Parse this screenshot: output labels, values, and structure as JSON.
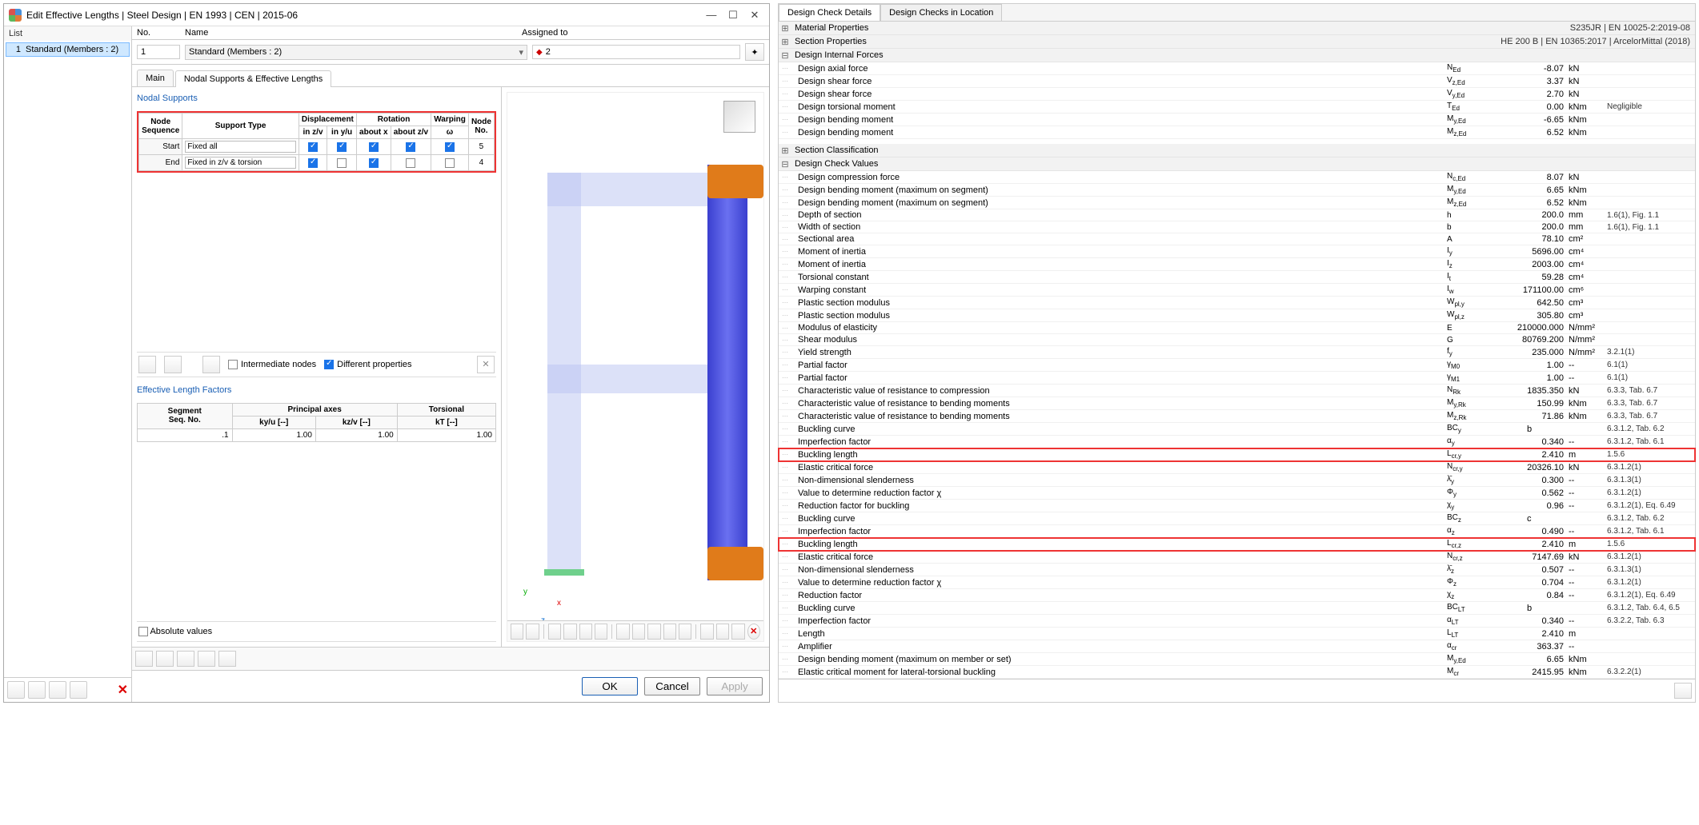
{
  "dialog": {
    "title": "Edit Effective Lengths | Steel Design | EN 1993 | CEN | 2015-06",
    "list_header": "List",
    "list_item_no": "1",
    "list_item_name": "Standard (Members : 2)",
    "hdr_no": "No.",
    "hdr_name": "Name",
    "hdr_assigned": "Assigned to",
    "val_no": "1",
    "val_name": "Standard (Members : 2)",
    "val_assigned": "2",
    "tab_main": "Main",
    "tab_nodal": "Nodal Supports & Effective Lengths",
    "section_nodal": "Nodal Supports",
    "ns_hdr": {
      "node_seq1": "Node",
      "node_seq2": "Sequence",
      "support_type": "Support Type",
      "disp": "Displacement",
      "in_zv": "in z/v",
      "in_yu": "in y/u",
      "rot": "Rotation",
      "about_x": "about x",
      "about_zv": "about z/v",
      "warp": "Warping",
      "omega": "ω",
      "node_no1": "Node",
      "node_no2": "No."
    },
    "ns_rows": [
      {
        "seq": "Start",
        "type": "Fixed all",
        "zv": true,
        "yu": true,
        "ax": true,
        "azv": true,
        "w": true,
        "node": "5"
      },
      {
        "seq": "End",
        "type": "Fixed in z/v & torsion",
        "zv": true,
        "yu": false,
        "ax": true,
        "azv": false,
        "w": false,
        "node": "4"
      }
    ],
    "chk_intermediate": "Intermediate nodes",
    "chk_different": "Different properties",
    "section_elf": "Effective Length Factors",
    "elf_hdr": {
      "seg1": "Segment",
      "seg2": "Seq. No.",
      "principal": "Principal axes",
      "ky": "ky/u [--]",
      "kz": "kz/v [--]",
      "torsional": "Torsional",
      "kt": "kT [--]"
    },
    "elf_row": {
      "seg": ".1",
      "ky": "1.00",
      "kz": "1.00",
      "kt": "1.00"
    },
    "chk_absolute": "Absolute values",
    "btn_ok": "OK",
    "btn_cancel": "Cancel",
    "btn_apply": "Apply"
  },
  "lcs": {
    "x": "x",
    "y": "y",
    "z": "z"
  },
  "props": {
    "tab1": "Design Check Details",
    "tab2": "Design Checks in Location",
    "cat_mat": "Material Properties",
    "cat_mat_val": "S235JR | EN 10025-2:2019-08",
    "cat_sec": "Section Properties",
    "cat_sec_val": "HE 200 B | EN 10365:2017 | ArcelorMittal (2018)",
    "cat_dif": "Design Internal Forces",
    "dif": [
      {
        "n": "Design axial force",
        "s": "N<sub>Ed</sub>",
        "v": "-8.07",
        "u": "kN",
        "r": ""
      },
      {
        "n": "Design shear force",
        "s": "V<sub>z,Ed</sub>",
        "v": "3.37",
        "u": "kN",
        "r": ""
      },
      {
        "n": "Design shear force",
        "s": "V<sub>y,Ed</sub>",
        "v": "2.70",
        "u": "kN",
        "r": ""
      },
      {
        "n": "Design torsional moment",
        "s": "T<sub>Ed</sub>",
        "v": "0.00",
        "u": "kNm",
        "r": "Negligible"
      },
      {
        "n": "Design bending moment",
        "s": "M<sub>y,Ed</sub>",
        "v": "-6.65",
        "u": "kNm",
        "r": ""
      },
      {
        "n": "Design bending moment",
        "s": "M<sub>z,Ed</sub>",
        "v": "6.52",
        "u": "kNm",
        "r": ""
      }
    ],
    "cat_cls": "Section Classification",
    "cat_dcv": "Design Check Values",
    "dcv": [
      {
        "n": "Design compression force",
        "s": "N<sub>c,Ed</sub>",
        "v": "8.07",
        "u": "kN",
        "r": ""
      },
      {
        "n": "Design bending moment (maximum on segment)",
        "s": "M<sub>y,Ed</sub>",
        "v": "6.65",
        "u": "kNm",
        "r": ""
      },
      {
        "n": "Design bending moment (maximum on segment)",
        "s": "M<sub>z,Ed</sub>",
        "v": "6.52",
        "u": "kNm",
        "r": ""
      },
      {
        "n": "Depth of section",
        "s": "h",
        "v": "200.0",
        "u": "mm",
        "r": "1.6(1), Fig. 1.1"
      },
      {
        "n": "Width of section",
        "s": "b",
        "v": "200.0",
        "u": "mm",
        "r": "1.6(1), Fig. 1.1"
      },
      {
        "n": "Sectional area",
        "s": "A",
        "v": "78.10",
        "u": "cm²",
        "r": ""
      },
      {
        "n": "Moment of inertia",
        "s": "I<sub>y</sub>",
        "v": "5696.00",
        "u": "cm⁴",
        "r": ""
      },
      {
        "n": "Moment of inertia",
        "s": "I<sub>z</sub>",
        "v": "2003.00",
        "u": "cm⁴",
        "r": ""
      },
      {
        "n": "Torsional constant",
        "s": "I<sub>t</sub>",
        "v": "59.28",
        "u": "cm⁴",
        "r": ""
      },
      {
        "n": "Warping constant",
        "s": "I<sub>w</sub>",
        "v": "171100.00",
        "u": "cm⁶",
        "r": ""
      },
      {
        "n": "Plastic section modulus",
        "s": "W<sub>pl,y</sub>",
        "v": "642.50",
        "u": "cm³",
        "r": ""
      },
      {
        "n": "Plastic section modulus",
        "s": "W<sub>pl,z</sub>",
        "v": "305.80",
        "u": "cm³",
        "r": ""
      },
      {
        "n": "Modulus of elasticity",
        "s": "E",
        "v": "210000.000",
        "u": "N/mm²",
        "r": ""
      },
      {
        "n": "Shear modulus",
        "s": "G",
        "v": "80769.200",
        "u": "N/mm²",
        "r": ""
      },
      {
        "n": "Yield strength",
        "s": "f<sub>y</sub>",
        "v": "235.000",
        "u": "N/mm²",
        "r": "3.2.1(1)"
      },
      {
        "n": "Partial factor",
        "s": "γ<sub>M0</sub>",
        "v": "1.00",
        "u": "--",
        "r": "6.1(1)"
      },
      {
        "n": "Partial factor",
        "s": "γ<sub>M1</sub>",
        "v": "1.00",
        "u": "--",
        "r": "6.1(1)"
      },
      {
        "n": "Characteristic value of resistance to compression",
        "s": "N<sub>Rk</sub>",
        "v": "1835.350",
        "u": "kN",
        "r": "6.3.3, Tab. 6.7"
      },
      {
        "n": "Characteristic value of resistance to bending moments",
        "s": "M<sub>y,Rk</sub>",
        "v": "150.99",
        "u": "kNm",
        "r": "6.3.3, Tab. 6.7"
      },
      {
        "n": "Characteristic value of resistance to bending moments",
        "s": "M<sub>z,Rk</sub>",
        "v": "71.86",
        "u": "kNm",
        "r": "6.3.3, Tab. 6.7"
      },
      {
        "n": "Buckling curve",
        "s": "BC<sub>y</sub>",
        "v": "b",
        "u": "",
        "r": "6.3.1.2, Tab. 6.2",
        "txt": true
      },
      {
        "n": "Imperfection factor",
        "s": "α<sub>y</sub>",
        "v": "0.340",
        "u": "--",
        "r": "6.3.1.2, Tab. 6.1"
      },
      {
        "n": "Buckling length",
        "s": "L<sub>cr,y</sub>",
        "v": "2.410",
        "u": "m",
        "r": "1.5.6",
        "hl": true
      },
      {
        "n": "Elastic critical force",
        "s": "N<sub>cr,y</sub>",
        "v": "20326.10",
        "u": "kN",
        "r": "6.3.1.2(1)"
      },
      {
        "n": "Non-dimensional slenderness",
        "s": "λ̄<sub>y</sub>",
        "v": "0.300",
        "u": "--",
        "r": "6.3.1.3(1)"
      },
      {
        "n": "Value to determine reduction factor χ",
        "s": "Φ<sub>y</sub>",
        "v": "0.562",
        "u": "--",
        "r": "6.3.1.2(1)"
      },
      {
        "n": "Reduction factor for buckling",
        "s": "χ<sub>y</sub>",
        "v": "0.96",
        "u": "--",
        "r": "6.3.1.2(1), Eq. 6.49"
      },
      {
        "n": "Buckling curve",
        "s": "BC<sub>z</sub>",
        "v": "c",
        "u": "",
        "r": "6.3.1.2, Tab. 6.2",
        "txt": true
      },
      {
        "n": "Imperfection factor",
        "s": "α<sub>z</sub>",
        "v": "0.490",
        "u": "--",
        "r": "6.3.1.2, Tab. 6.1"
      },
      {
        "n": "Buckling length",
        "s": "L<sub>cr,z</sub>",
        "v": "2.410",
        "u": "m",
        "r": "1.5.6",
        "hl": true
      },
      {
        "n": "Elastic critical force",
        "s": "N<sub>cr,z</sub>",
        "v": "7147.69",
        "u": "kN",
        "r": "6.3.1.2(1)"
      },
      {
        "n": "Non-dimensional slenderness",
        "s": "λ̄<sub>z</sub>",
        "v": "0.507",
        "u": "--",
        "r": "6.3.1.3(1)"
      },
      {
        "n": "Value to determine reduction factor χ",
        "s": "Φ<sub>z</sub>",
        "v": "0.704",
        "u": "--",
        "r": "6.3.1.2(1)"
      },
      {
        "n": "Reduction factor",
        "s": "χ<sub>z</sub>",
        "v": "0.84",
        "u": "--",
        "r": "6.3.1.2(1), Eq. 6.49"
      },
      {
        "n": "Buckling curve",
        "s": "BC<sub>LT</sub>",
        "v": "b",
        "u": "",
        "r": "6.3.1.2, Tab. 6.4, 6.5",
        "txt": true
      },
      {
        "n": "Imperfection factor",
        "s": "α<sub>LT</sub>",
        "v": "0.340",
        "u": "--",
        "r": "6.3.2.2, Tab. 6.3"
      },
      {
        "n": "Length",
        "s": "L<sub>LT</sub>",
        "v": "2.410",
        "u": "m",
        "r": ""
      },
      {
        "n": "Amplifier",
        "s": "α<sub>cr</sub>",
        "v": "363.37",
        "u": "--",
        "r": ""
      },
      {
        "n": "Design bending moment (maximum on member or set)",
        "s": "M<sub>y,Ed</sub>",
        "v": "6.65",
        "u": "kNm",
        "r": ""
      },
      {
        "n": "Elastic critical moment for lateral-torsional buckling",
        "s": "M<sub>cr</sub>",
        "v": "2415.95",
        "u": "kNm",
        "r": "6.3.2.2(1)"
      }
    ]
  }
}
